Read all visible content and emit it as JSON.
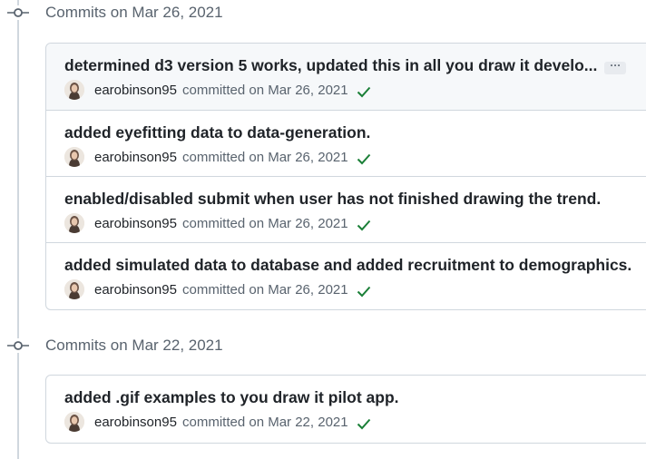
{
  "groups": [
    {
      "title": "Commits on Mar 26, 2021",
      "commits": [
        {
          "message": "determined d3 version 5 works, updated this in all you draw it develo...",
          "author": "earobinson95",
          "committed": "committed on Mar 26, 2021",
          "has_more": true
        },
        {
          "message": "added eyefitting data to data-generation.",
          "author": "earobinson95",
          "committed": "committed on Mar 26, 2021",
          "has_more": false
        },
        {
          "message": "enabled/disabled submit when user has not finished drawing the trend.",
          "author": "earobinson95",
          "committed": "committed on Mar 26, 2021",
          "has_more": false
        },
        {
          "message": "added simulated data to database and added recruitment to demographics.",
          "author": "earobinson95",
          "committed": "committed on Mar 26, 2021",
          "has_more": false
        }
      ]
    },
    {
      "title": "Commits on Mar 22, 2021",
      "commits": [
        {
          "message": "added .gif examples to you draw it pilot app.",
          "author": "earobinson95",
          "committed": "committed on Mar 22, 2021",
          "has_more": false
        }
      ]
    }
  ],
  "ellipsis_label": "···",
  "colors": {
    "check": "#1a7f37",
    "timeline": "#d0d7de",
    "muted": "#59636e"
  },
  "icons": {
    "group": "git-commit-icon",
    "status": "check-icon"
  }
}
